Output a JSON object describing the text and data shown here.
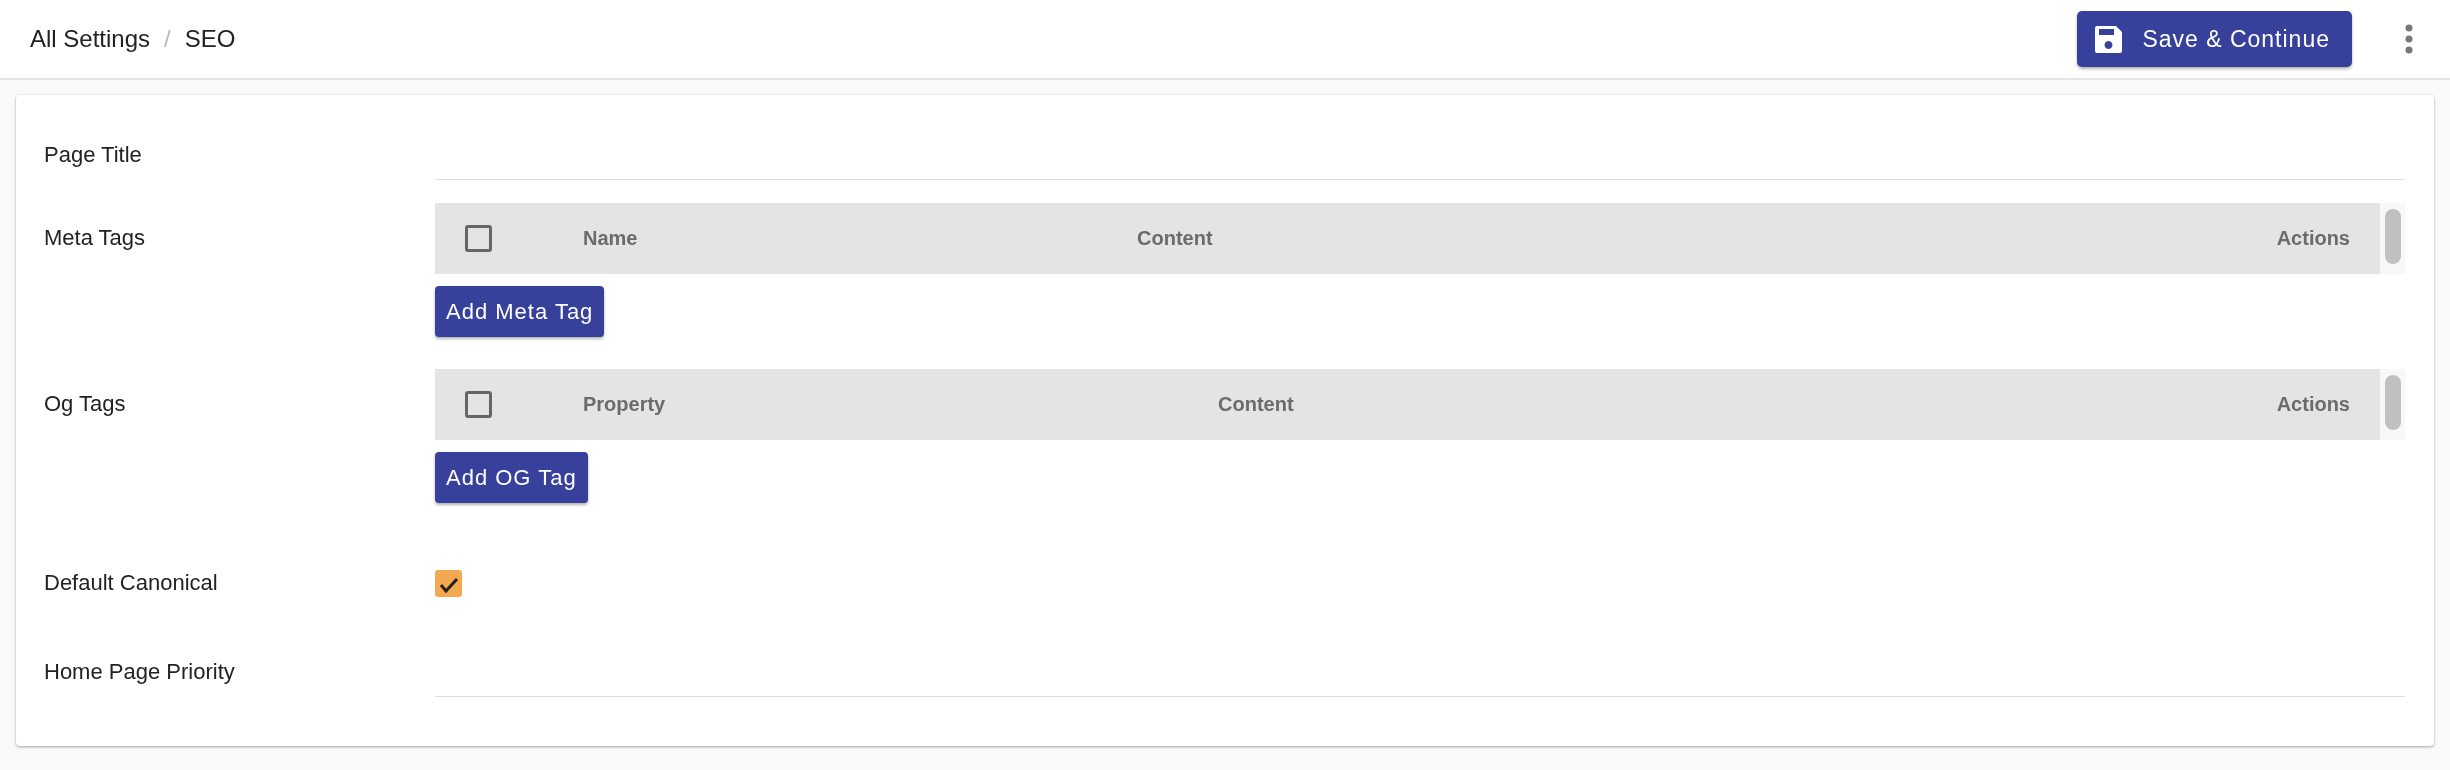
{
  "header": {
    "breadcrumb": [
      {
        "label": "All Settings"
      },
      {
        "label": "SEO"
      }
    ],
    "separator": "/",
    "save_button": "Save & Continue"
  },
  "form": {
    "rows": [
      {
        "kind": "text",
        "label": "Page Title"
      },
      {
        "kind": "table",
        "label": "Meta Tags",
        "select_all_checked": false,
        "columns": [
          "Name",
          "Content",
          "Actions"
        ],
        "add_button": "Add Meta Tag"
      },
      {
        "kind": "table",
        "label": "Og Tags",
        "select_all_checked": false,
        "columns": [
          "Property",
          "Content",
          "Actions"
        ],
        "add_button": "Add OG Tag"
      },
      {
        "kind": "checkbox",
        "label": "Default Canonical",
        "checked": true
      },
      {
        "kind": "text",
        "label": "Home Page Priority"
      }
    ]
  }
}
